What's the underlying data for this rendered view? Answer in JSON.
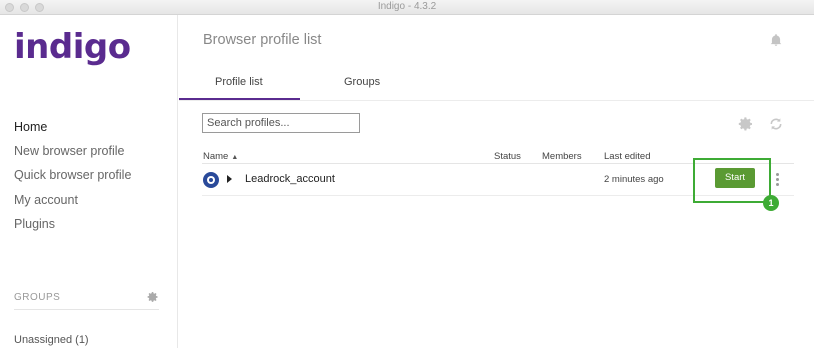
{
  "window": {
    "title": "Indigo - 4.3.2"
  },
  "sidebar": {
    "logo": "indigo",
    "nav": [
      {
        "label": "Home",
        "active": true
      },
      {
        "label": "New browser profile",
        "active": false
      },
      {
        "label": "Quick browser profile",
        "active": false
      },
      {
        "label": "My account",
        "active": false
      },
      {
        "label": "Plugins",
        "active": false
      }
    ],
    "groups_heading": "GROUPS",
    "groups": [
      {
        "label": "Unassigned (1)"
      }
    ]
  },
  "main": {
    "title": "Browser profile list",
    "tabs": [
      {
        "label": "Profile list",
        "active": true
      },
      {
        "label": "Groups",
        "active": false
      }
    ],
    "search": {
      "placeholder": "Search profiles...",
      "value": ""
    },
    "table": {
      "columns": [
        "Name",
        "Status",
        "Members",
        "Last edited"
      ],
      "rows": [
        {
          "name": "Leadrock_account",
          "status": "",
          "members": "",
          "last_edited": "2 minutes ago",
          "action": "Start"
        }
      ]
    },
    "annotation_badge": "1"
  },
  "colors": {
    "brand": "#5a2b8f",
    "start_button": "#5a9a33",
    "highlight": "#3eab35"
  },
  "icons": [
    "bell-icon",
    "gear-icon",
    "refresh-icon",
    "sort-asc-icon",
    "expand-caret-icon",
    "browser-icon",
    "more-vertical-icon"
  ]
}
